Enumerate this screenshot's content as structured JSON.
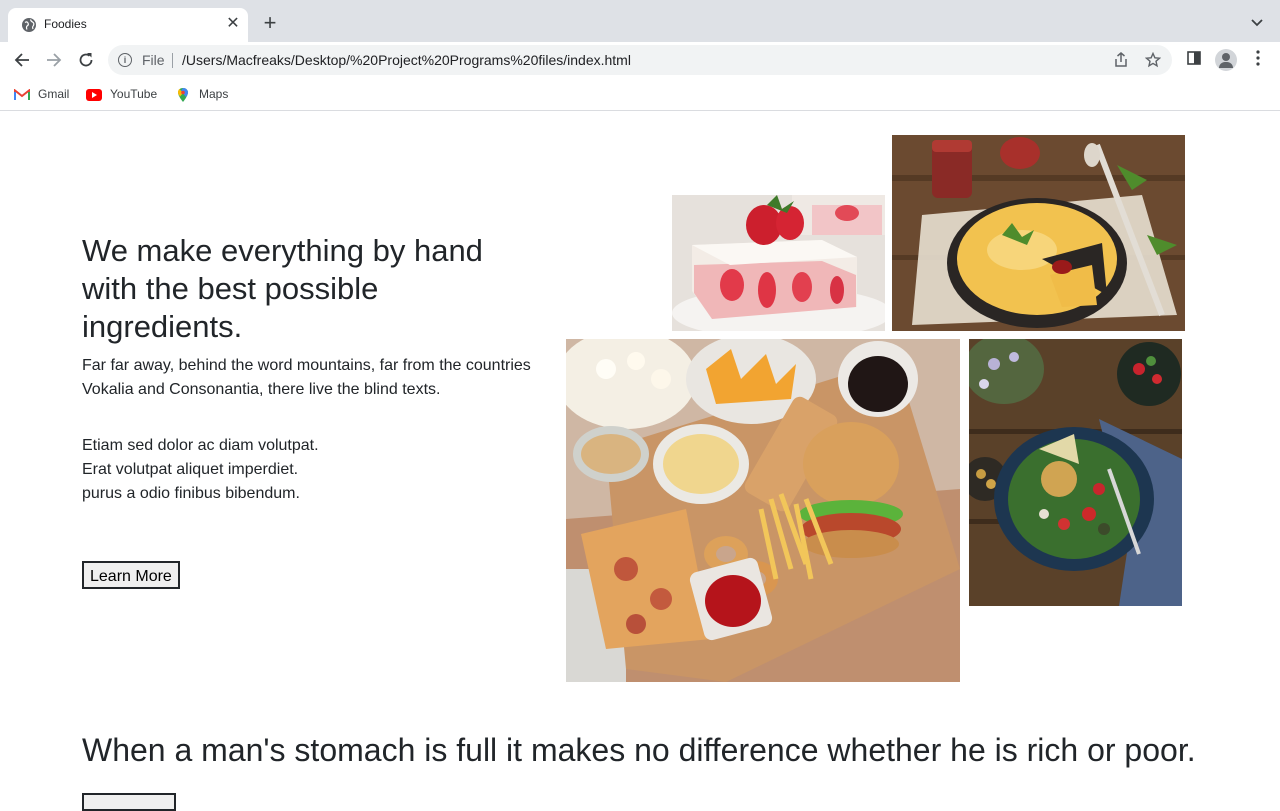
{
  "browser": {
    "tab_title": "Foodies",
    "url_scheme": "File",
    "url": "/Users/Macfreaks/Desktop/%20Project%20Programs%20files/index.html",
    "bookmarks": [
      {
        "label": "Gmail"
      },
      {
        "label": "YouTube"
      },
      {
        "label": "Maps"
      }
    ]
  },
  "hero": {
    "headline": "We make everything by hand with the best possible ingredients.",
    "paragraph": "Far far away, behind the word mountains, far from the countries Vokalia and Consonantia, there live the blind texts.",
    "lines": [
      "Etiam sed dolor ac diam volutpat.",
      "Erat volutpat aliquet imperdiet.",
      "purus a odio finibus bibendum."
    ],
    "button_label": "Learn More"
  },
  "quote": {
    "text": "When a man's stomach is full it makes no difference whether he is rich or poor."
  }
}
